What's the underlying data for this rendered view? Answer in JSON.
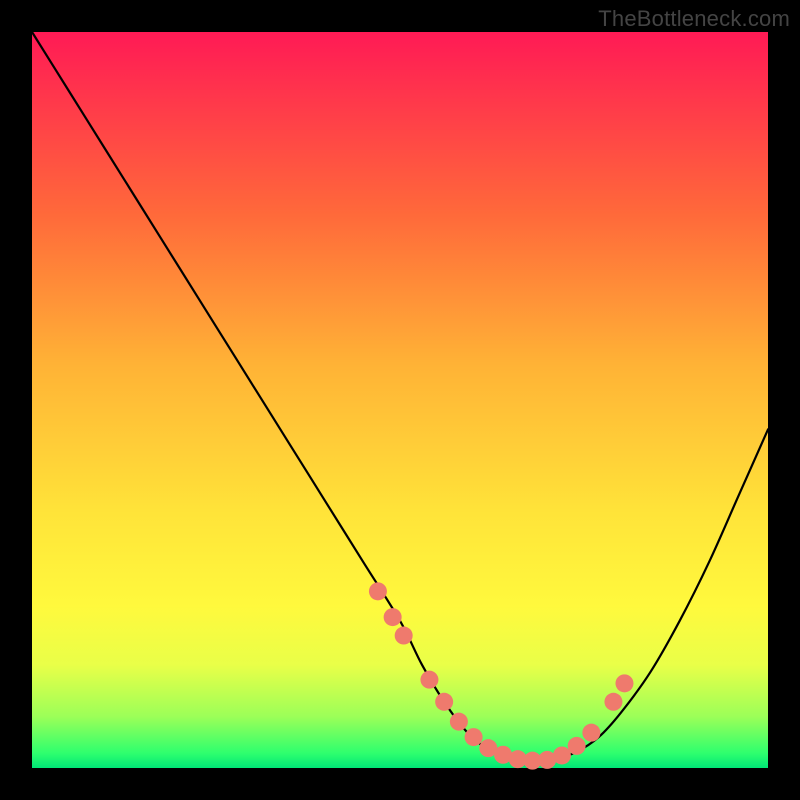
{
  "watermark": "TheBottleneck.com",
  "colors": {
    "gradient_top": "#ff1a55",
    "gradient_mid": "#ffe339",
    "gradient_bottom": "#00e676",
    "curve": "#000000",
    "dots": "#ef7a6d",
    "frame": "#000000"
  },
  "chart_data": {
    "type": "line",
    "title": "",
    "xlabel": "",
    "ylabel": "",
    "xlim": [
      0,
      100
    ],
    "ylim": [
      0,
      100
    ],
    "grid": false,
    "legend": null,
    "series": [
      {
        "name": "bottleneck-curve",
        "x": [
          0,
          5,
          10,
          15,
          20,
          25,
          30,
          35,
          40,
          45,
          50,
          53,
          56,
          59,
          62,
          65,
          68,
          71,
          74,
          77,
          80,
          84,
          88,
          92,
          96,
          100
        ],
        "y": [
          100,
          92,
          84,
          76,
          68,
          60,
          52,
          44,
          36,
          28,
          20,
          14,
          9,
          5,
          2.5,
          1.3,
          1,
          1.2,
          2.2,
          4.2,
          7.5,
          13,
          20,
          28,
          37,
          46
        ]
      }
    ],
    "markers": {
      "name": "highlight-dots",
      "x": [
        47,
        49,
        50.5,
        54,
        56,
        58,
        60,
        62,
        64,
        66,
        68,
        70,
        72,
        74,
        76,
        79,
        80.5
      ],
      "y": [
        24,
        20.5,
        18,
        12,
        9,
        6.3,
        4.2,
        2.7,
        1.8,
        1.2,
        1,
        1.1,
        1.7,
        3,
        4.8,
        9,
        11.5
      ]
    }
  }
}
